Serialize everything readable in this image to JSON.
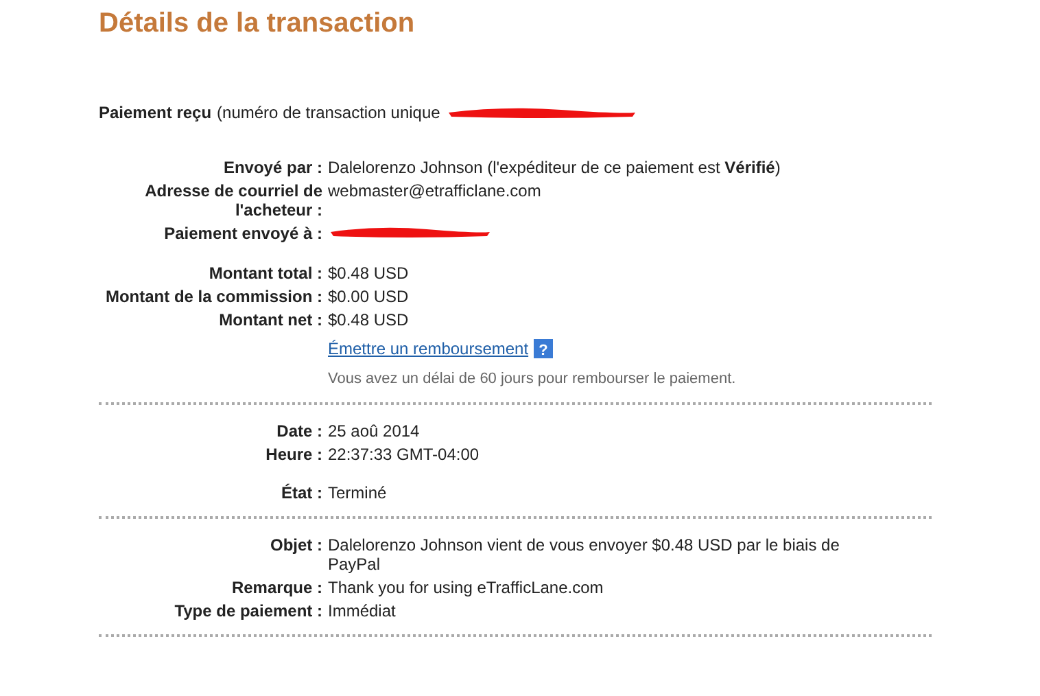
{
  "title": "Détails de la transaction",
  "header": {
    "label": "Paiement reçu",
    "text": "(numéro de transaction unique",
    "redacted": true
  },
  "sections": [
    {
      "rows": [
        {
          "kind": "field",
          "label": "Envoyé par :",
          "value": "Dalelorenzo Johnson (l'expéditeur de ce paiement est **Vérifié**)"
        },
        {
          "kind": "field",
          "label": "Adresse de courriel de l'acheteur :",
          "value": "webmaster@etrafficlane.com"
        },
        {
          "kind": "redacted",
          "label": "Paiement envoyé à :"
        },
        {
          "kind": "spacer"
        },
        {
          "kind": "field",
          "label": "Montant total :",
          "value": "$0.48 USD"
        },
        {
          "kind": "field",
          "label": "Montant de la commission :",
          "value": "$0.00 USD"
        },
        {
          "kind": "field",
          "label": "Montant net :",
          "value": "$0.48 USD"
        },
        {
          "kind": "link",
          "text": "Émettre un remboursement",
          "help": "?"
        },
        {
          "kind": "note",
          "text": "Vous avez un délai de 60 jours pour rembourser le paiement."
        }
      ]
    },
    {
      "rows": [
        {
          "kind": "field",
          "label": "Date :",
          "value": "25 aoû 2014"
        },
        {
          "kind": "field",
          "label": "Heure :",
          "value": "22:37:33 GMT-04:00"
        },
        {
          "kind": "spacer"
        },
        {
          "kind": "field",
          "label": "État :",
          "value": "Terminé"
        }
      ]
    },
    {
      "rows": [
        {
          "kind": "field",
          "label": "Objet :",
          "value": "Dalelorenzo Johnson vient de vous envoyer $0.48 USD par le biais de PayPal"
        },
        {
          "kind": "field",
          "label": "Remarque :",
          "value": "Thank you for using eTrafficLane.com"
        },
        {
          "kind": "field",
          "label": "Type de paiement :",
          "value": "Immédiat"
        }
      ]
    }
  ]
}
